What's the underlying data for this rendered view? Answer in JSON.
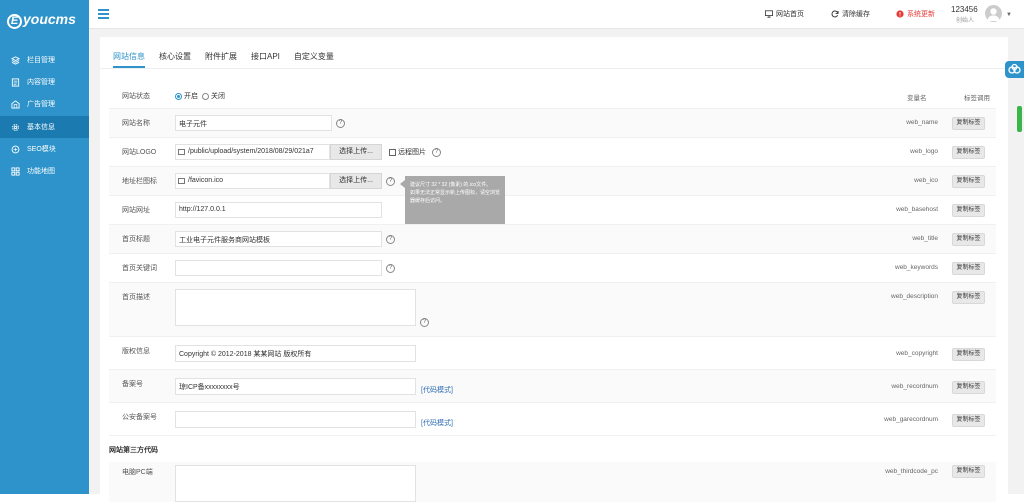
{
  "brand": {
    "letter": "E",
    "name": "youcms"
  },
  "sidebar": {
    "items": [
      {
        "label": "栏目管理",
        "icon": "layers-icon"
      },
      {
        "label": "内容管理",
        "icon": "document-icon"
      },
      {
        "label": "广告管理",
        "icon": "ad-icon"
      },
      {
        "label": "基本信息",
        "icon": "gear-icon",
        "active": true
      },
      {
        "label": "SEO模块",
        "icon": "seo-icon"
      },
      {
        "label": "功能地图",
        "icon": "grid-icon"
      }
    ]
  },
  "topbar": {
    "home": "网站首页",
    "clear_cache": "清除缓存",
    "update": "系统更新",
    "user_name": "123456",
    "user_role": "创始人"
  },
  "tabs": [
    "网站信息",
    "核心设置",
    "附件扩展",
    "接口API",
    "自定义变量"
  ],
  "table_headers": {
    "varname": "变量名",
    "tag": "标签调用"
  },
  "copy_label": "复制标签",
  "rows": {
    "status": {
      "label": "网站状态",
      "on": "开启",
      "off": "关闭",
      "selected": "开启"
    },
    "name": {
      "label": "网站名称",
      "value": "电子元件",
      "var": "web_name"
    },
    "logo": {
      "label": "网站LOGO",
      "value": "/public/upload/system/2018/08/29/021a7",
      "upload": "选择上传...",
      "remote": "远程图片",
      "var": "web_logo"
    },
    "ico": {
      "label": "地址栏图标",
      "value": "/favicon.ico",
      "upload": "选择上传...",
      "var": "web_ico"
    },
    "basehost": {
      "label": "网站网址",
      "value": "http://127.0.0.1",
      "var": "web_basehost"
    },
    "title": {
      "label": "首页标题",
      "value": "工业电子元件服务商网站模板",
      "var": "web_title"
    },
    "keywords": {
      "label": "首页关键词",
      "value": "",
      "var": "web_keywords"
    },
    "description": {
      "label": "首页描述",
      "value": "",
      "var": "web_description"
    },
    "copyright": {
      "label": "版权信息",
      "value": "Copyright © 2012-2018 某某网站 版权所有",
      "var": "web_copyright"
    },
    "recordnum": {
      "label": "备案号",
      "value": "琼ICP备xxxxxxxx号",
      "code": "[代码模式]",
      "var": "web_recordnum"
    },
    "garecordnum": {
      "label": "公安备案号",
      "value": "",
      "code": "[代码模式]",
      "var": "web_garecordnum"
    },
    "section_third": {
      "label": "网站第三方代码"
    },
    "thirdcode_pc": {
      "label": "电脑PC端",
      "var": "web_thirdcode_pc"
    }
  },
  "tooltip": {
    "line1": "建议尺寸 32 * 32 (像素) 的.ico文件。",
    "line2": "如果无法正常显示新上传图标，请空浏览器缓存后访问。"
  },
  "colors": {
    "primary": "#2d93ca",
    "sidebar_active": "#1b7bb0",
    "update_red": "#e53935",
    "link": "#2d6cb5"
  }
}
